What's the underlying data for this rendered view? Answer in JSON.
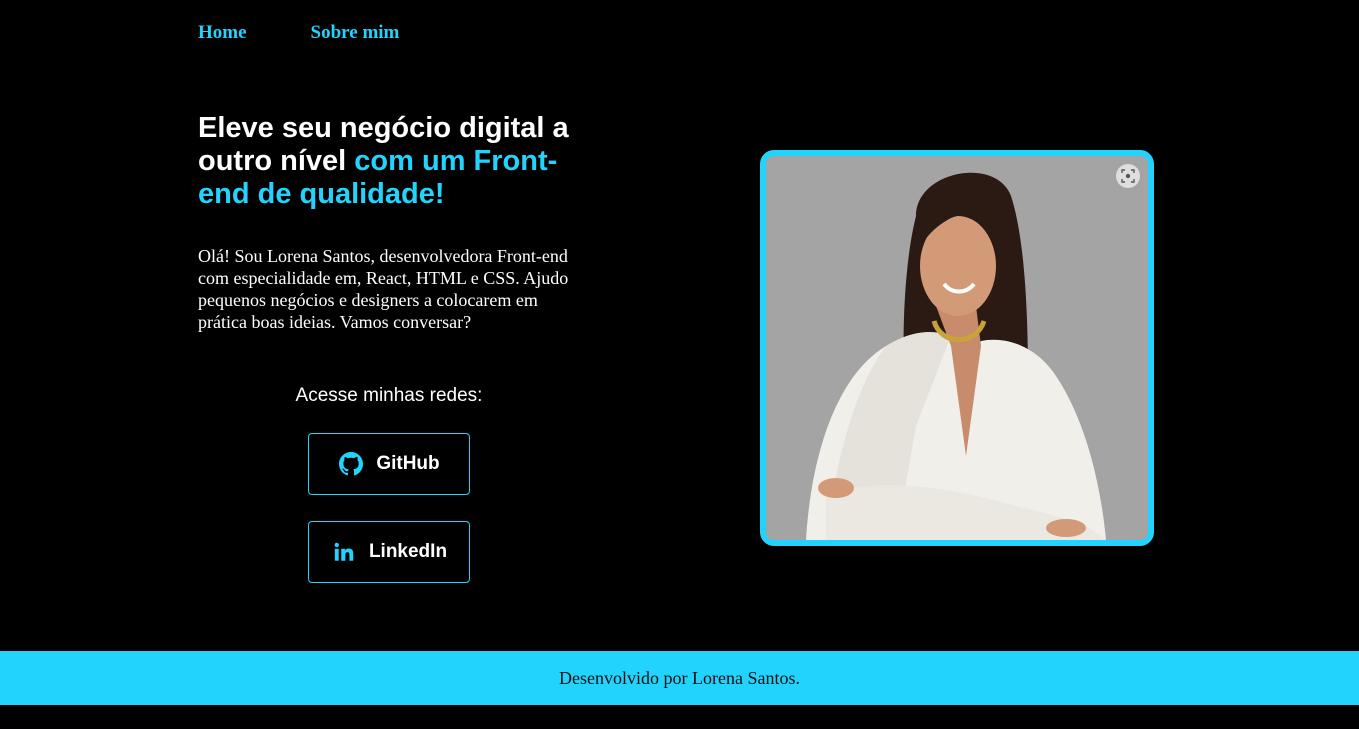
{
  "nav": {
    "home": "Home",
    "about": "Sobre mim"
  },
  "hero": {
    "headline_part1": "Eleve seu negócio digital a outro nível ",
    "headline_accent": "com um Front-end de qualidade!",
    "intro": "Olá! Sou Lorena Santos, desenvolvedora Front-end com especialidade em, React, HTML e CSS. Ajudo pequenos negócios e designers a colocarem em prática boas ideias. Vamos conversar?"
  },
  "social": {
    "title": "Acesse minhas redes:",
    "github_label": "GitHub",
    "github_icon": "github-icon",
    "linkedin_label": "LinkedIn",
    "linkedin_icon": "linkedin-icon"
  },
  "photo": {
    "alt": "Foto de Lorena Santos",
    "lens_icon": "visual-search-icon"
  },
  "footer": {
    "text": "Desenvolvido por Lorena Santos."
  },
  "colors": {
    "accent": "#22d4fd",
    "background": "#000000",
    "photo_bg": "#a4a4a4"
  }
}
